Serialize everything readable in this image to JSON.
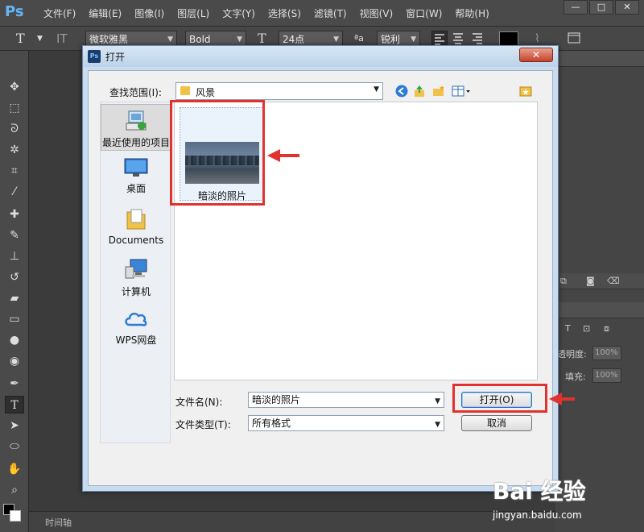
{
  "app": {
    "logo": "Ps"
  },
  "menubar": {
    "items": [
      "文件(F)",
      "编辑(E)",
      "图像(I)",
      "图层(L)",
      "文字(Y)",
      "选择(S)",
      "滤镜(T)",
      "视图(V)",
      "窗口(W)",
      "帮助(H)"
    ],
    "window_controls": [
      "—",
      "□",
      "✕"
    ]
  },
  "options_bar": {
    "font_family": "微软雅黑",
    "font_style": "Bold",
    "font_size": "24点",
    "antialias_label": "ªa",
    "antialias": "锐利"
  },
  "right_panel": {
    "opacity_label": "透明度:",
    "opacity_value": "100%",
    "fill_label": "填充:",
    "fill_value": "100%"
  },
  "bottom_strip": {
    "timeline_label": "时间轴"
  },
  "dialog": {
    "title": "打开",
    "icon_text": "Ps",
    "close_label": "✕",
    "look_in_label": "查找范围(I):",
    "look_in_value": "风景",
    "places": [
      {
        "label": "最近使用的项目",
        "icon": "recent-items-icon"
      },
      {
        "label": "桌面",
        "icon": "desktop-icon"
      },
      {
        "label": "Documents",
        "icon": "documents-folder-icon"
      },
      {
        "label": "计算机",
        "icon": "computer-icon"
      },
      {
        "label": "WPS网盘",
        "icon": "wps-cloud-icon"
      }
    ],
    "file": {
      "name": "暗淡的照片"
    },
    "filename_label": "文件名(N):",
    "filename_value": "暗淡的照片",
    "filetype_label": "文件类型(T):",
    "filetype_value": "所有格式",
    "open_button": "打开(O)",
    "cancel_button": "取消"
  },
  "watermark": {
    "logo": "Bai 经验",
    "sub": "jingyan.baidu.com"
  },
  "colors": {
    "annotation_red": "#e0322f",
    "ps_dark": "#3b3b3b",
    "dialog_frame": "#c9dbee"
  }
}
